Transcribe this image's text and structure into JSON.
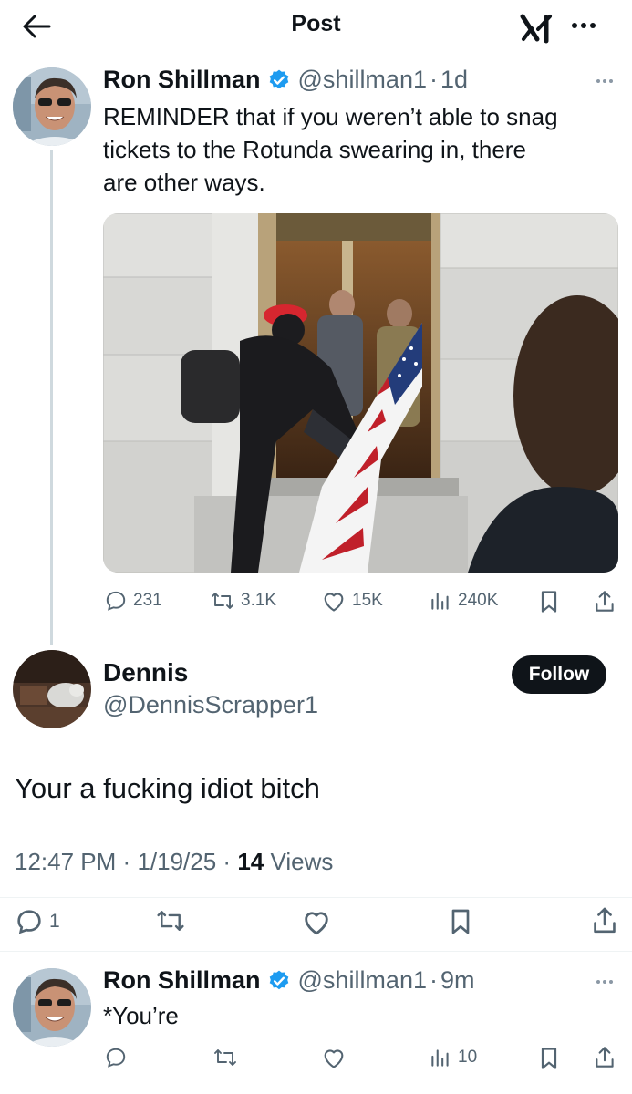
{
  "header": {
    "title": "Post"
  },
  "original_tweet": {
    "name": "Ron Shillman",
    "handle": "@shillman1",
    "separator": "·",
    "time": "1d",
    "text_lines": [
      "REMINDER that if you weren’t able to snag",
      "tickets to the Rotunda swearing in, there",
      "are other ways."
    ],
    "stats": {
      "replies": "231",
      "reposts": "3.1K",
      "likes": "15K",
      "views": "240K"
    }
  },
  "focused_reply": {
    "name": "Dennis",
    "handle": "@DennisScrapper1",
    "follow_label": "Follow",
    "text": "Your a fucking idiot bitch",
    "time": "12:47 PM",
    "date": "1/19/25",
    "separator": "·",
    "views_count": "14",
    "views_label": "Views",
    "stats": {
      "replies": "1"
    }
  },
  "bottom_reply": {
    "name": "Ron Shillman",
    "handle": "@shillman1",
    "separator": "·",
    "time": "9m",
    "text": "*You’re",
    "stats": {
      "views": "10"
    }
  },
  "colors": {
    "text": "#0f1419",
    "secondary": "#536471",
    "verified": "#1d9bf0",
    "divider": "#eff3f4"
  }
}
